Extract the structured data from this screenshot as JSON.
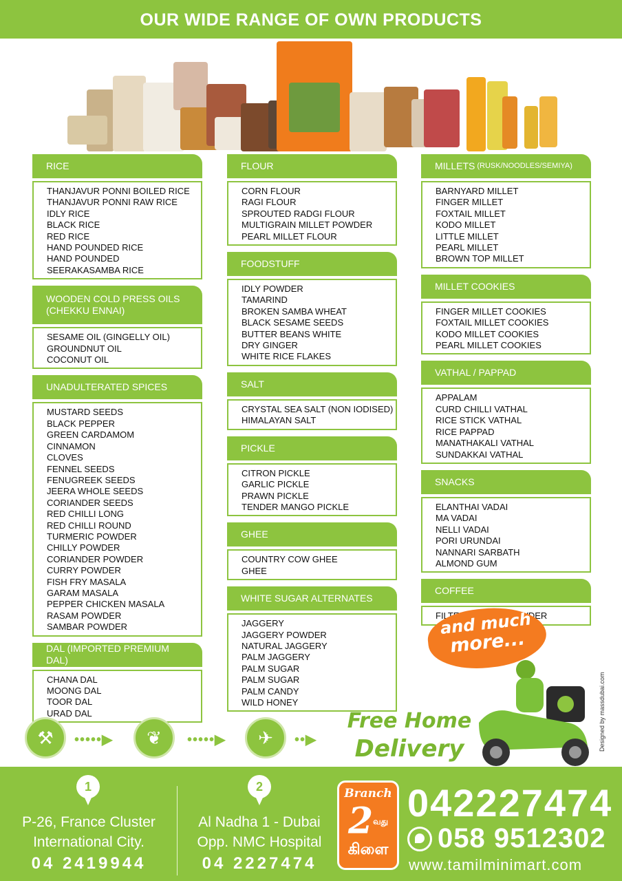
{
  "header": {
    "title": "OUR WIDE RANGE OF OWN PRODUCTS"
  },
  "columns": [
    {
      "categories": [
        {
          "title": "RICE",
          "items": [
            "THANJAVUR PONNI BOILED RICE",
            "THANJAVUR PONNI RAW  RICE",
            "IDLY RICE",
            "BLACK RICE",
            "RED RICE",
            "HAND POUNDED  RICE",
            "HAND POUNDED",
            "SEERAKASAMBA RICE"
          ]
        },
        {
          "title": "WOODEN COLD PRESS OILS (CHEKKU ENNAI)",
          "items": [
            "SESAME OIL (GINGELLY OIL)",
            "GROUNDNUT OIL",
            "COCONUT OIL"
          ]
        },
        {
          "title": "UNADULTERATED SPICES",
          "items": [
            "MUSTARD SEEDS",
            "BLACK PEPPER",
            "GREEN CARDAMOM",
            "CINNAMON",
            "CLOVES",
            "FENNEL SEEDS",
            "FENUGREEK SEEDS",
            "JEERA WHOLE SEEDS",
            "CORIANDER SEEDS",
            "RED CHILLI LONG",
            "RED CHILLI ROUND",
            "TURMERIC POWDER",
            "CHILLY POWDER",
            "CORIANDER POWDER",
            "CURRY POWDER",
            "FISH FRY MASALA",
            "GARAM MASALA",
            "PEPPER CHICKEN MASALA",
            "RASAM POWDER",
            "SAMBAR POWDER"
          ]
        },
        {
          "title": "DAL (IMPORTED PREMIUM DAL)",
          "items": [
            "CHANA DAL",
            "MOONG DAL",
            "TOOR DAL",
            "URAD DAL"
          ]
        }
      ]
    },
    {
      "categories": [
        {
          "title": "FLOUR",
          "items": [
            "CORN FLOUR",
            "RAGI FLOUR",
            "SPROUTED RADGI FLOUR",
            "MULTIGRAIN MILLET POWDER",
            "PEARL MILLET FLOUR"
          ]
        },
        {
          "title": "FOODSTUFF",
          "items": [
            "IDLY POWDER",
            "TAMARIND",
            "BROKEN SAMBA WHEAT",
            "BLACK SESAME SEEDS",
            "BUTTER BEANS WHITE",
            "DRY GINGER",
            "WHITE RICE FLAKES"
          ]
        },
        {
          "title": "SALT",
          "items": [
            "CRYSTAL SEA SALT (NON IODISED)",
            "HIMALAYAN SALT"
          ]
        },
        {
          "title": "PICKLE",
          "items": [
            "CITRON PICKLE",
            "GARLIC PICKLE",
            "PRAWN PICKLE",
            "TENDER MANGO PICKLE"
          ]
        },
        {
          "title": "GHEE",
          "items": [
            "COUNTRY COW GHEE",
            "GHEE"
          ]
        },
        {
          "title": "WHITE SUGAR ALTERNATES",
          "items": [
            "JAGGERY",
            "JAGGERY POWDER",
            "NATURAL JAGGERY",
            "PALM JAGGERY",
            "PALM SUGAR",
            "PALM SUGAR",
            "PALM CANDY",
            "WILD HONEY"
          ]
        }
      ]
    },
    {
      "categories": [
        {
          "title": "MILLETS",
          "subtitle": "(RUSK/NOODLES/SEMIYA)",
          "items": [
            "BARNYARD MILLET",
            "FINGER MILLET",
            "FOXTAIL MILLET",
            "KODO MILLET",
            "LITTLE MILLET",
            "PEARL MILLET",
            "BROWN TOP MILLET"
          ]
        },
        {
          "title": "MILLET COOKIES",
          "items": [
            "FINGER MILLET COOKIES",
            "FOXTAIL MILLET COOKIES",
            "KODO MILLET COOKIES",
            "PEARL MILLET COOKIES"
          ]
        },
        {
          "title": "VATHAL / PAPPAD",
          "items": [
            "APPALAM",
            "CURD CHILLI VATHAL",
            "RICE STICK VATHAL",
            "RICE PAPPAD",
            "MANATHAKALI VATHAL",
            "SUNDAKKAI VATHAL"
          ]
        },
        {
          "title": "SNACKS",
          "items": [
            "ELANTHAI VADAI",
            "MA VADAI",
            "NELLI VADAI",
            "PORI URUNDAI",
            "NANNARI SARBATH",
            "ALMOND GUM"
          ]
        },
        {
          "title": "COFFEE",
          "items": [
            "FILTER COFFEE POWDER"
          ]
        }
      ]
    }
  ],
  "promo": {
    "much_line1": "and much",
    "much_line2": "more...",
    "free_line1": "Free Home",
    "free_line2": "Delivery"
  },
  "steps_icons": [
    "plough-icon",
    "leaf-icon",
    "airplane-icon"
  ],
  "credit": "Designed by massdubai.com",
  "branches": [
    {
      "number": "1",
      "line1": "P-26, France Cluster",
      "line2": "International City.",
      "phone": "04 2419944"
    },
    {
      "number": "2",
      "line1": "Al Nadha 1 - Dubai",
      "line2": "Opp. NMC Hospital",
      "phone": "04 2227474"
    }
  ],
  "branch_badge": {
    "label": "Branch",
    "number": "2",
    "suffix": "வது",
    "tamil": "கிளை"
  },
  "contact": {
    "phone": "042227474",
    "whatsapp": "058 9512302",
    "website": "www.tamilminimart.com"
  },
  "colors": {
    "brand_green": "#8dc43f",
    "accent_orange": "#f47b20"
  }
}
